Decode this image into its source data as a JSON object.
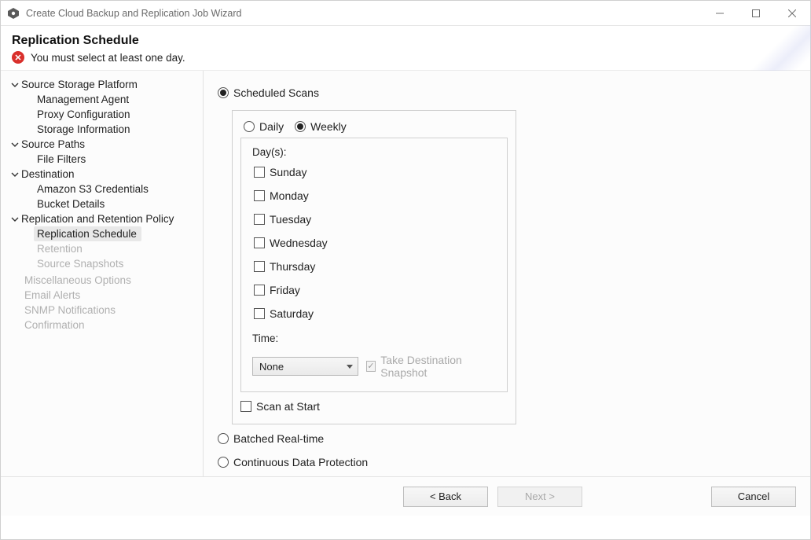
{
  "window": {
    "title": "Create Cloud Backup and Replication Job Wizard"
  },
  "header": {
    "title": "Replication Schedule",
    "error_message": "You must select at least one day."
  },
  "sidebar": {
    "groups": [
      {
        "label": "Source Storage Platform",
        "items": [
          "Management Agent",
          "Proxy Configuration",
          "Storage Information"
        ],
        "disabled": false
      },
      {
        "label": "Source Paths",
        "items": [
          "File Filters"
        ],
        "disabled": false
      },
      {
        "label": "Destination",
        "items": [
          "Amazon S3 Credentials",
          "Bucket Details"
        ],
        "disabled": false
      },
      {
        "label": "Replication and Retention Policy",
        "items": [
          "Replication Schedule",
          "Retention",
          "Source Snapshots"
        ],
        "disabled": false,
        "selected_index": 0,
        "item_disabled": [
          false,
          true,
          true
        ]
      }
    ],
    "flat_disabled": [
      "Miscellaneous Options",
      "Email Alerts",
      "SNMP Notifications",
      "Confirmation"
    ]
  },
  "main": {
    "mode_scheduled": "Scheduled Scans",
    "mode_batched": "Batched Real-time",
    "mode_cdp": "Continuous Data Protection",
    "freq_daily": "Daily",
    "freq_weekly": "Weekly",
    "days_label": "Day(s):",
    "days": [
      "Sunday",
      "Monday",
      "Tuesday",
      "Wednesday",
      "Thursday",
      "Friday",
      "Saturday"
    ],
    "time_label": "Time:",
    "time_value": "None",
    "snapshot_label": "Take Destination Snapshot",
    "scan_at_start": "Scan at Start"
  },
  "footer": {
    "back": "< Back",
    "next": "Next >",
    "cancel": "Cancel"
  }
}
